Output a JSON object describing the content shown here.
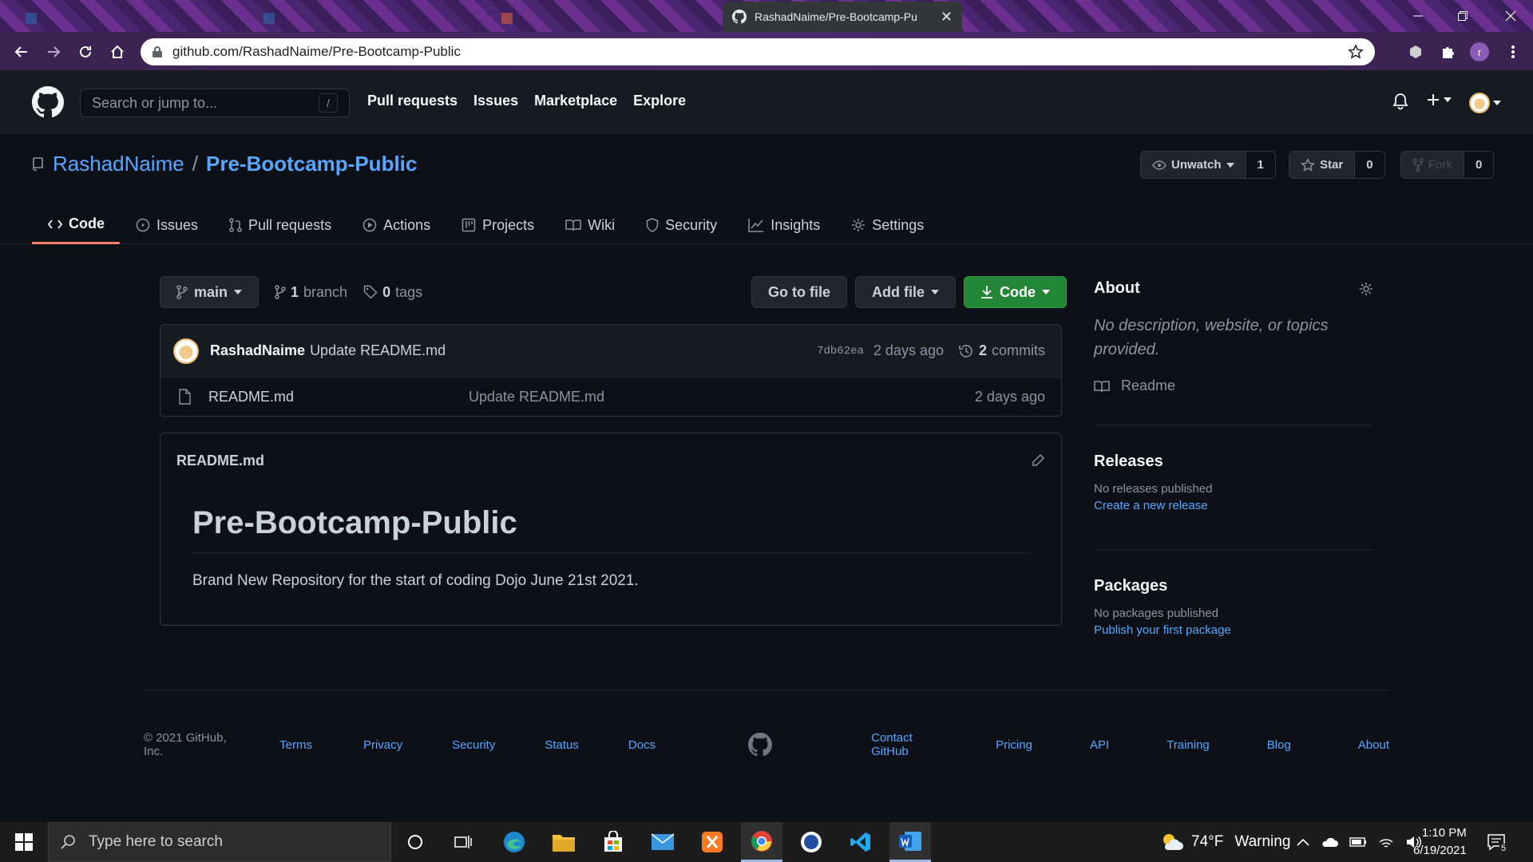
{
  "browser": {
    "active_tab_title": "RashadNaime/Pre-Bootcamp-Pu",
    "url": "github.com/RashadNaime/Pre-Bootcamp-Public",
    "profile_initial": "r"
  },
  "gh_header": {
    "search_placeholder": "Search or jump to...",
    "search_shortcut": "/",
    "nav": [
      "Pull requests",
      "Issues",
      "Marketplace",
      "Explore"
    ]
  },
  "repo": {
    "owner": "RashadNaime",
    "separator": "/",
    "name": "Pre-Bootcamp-Public",
    "unwatch_label": "Unwatch",
    "watch_count": "1",
    "star_label": "Star",
    "star_count": "0",
    "fork_label": "Fork",
    "fork_count": "0"
  },
  "tabs": [
    "Code",
    "Issues",
    "Pull requests",
    "Actions",
    "Projects",
    "Wiki",
    "Security",
    "Insights",
    "Settings"
  ],
  "file_nav": {
    "branch": "main",
    "branch_count": "1",
    "branch_word": "branch",
    "tag_count": "0",
    "tag_word": "tags",
    "go_to_file": "Go to file",
    "add_file": "Add file",
    "code": "Code"
  },
  "latest_commit": {
    "author": "RashadNaime",
    "message": "Update README.md",
    "sha": "7db62ea",
    "time": "2 days ago",
    "commit_count": "2",
    "commit_word": "commits"
  },
  "files": [
    {
      "name": "README.md",
      "message": "Update README.md",
      "time": "2 days ago"
    }
  ],
  "readme": {
    "filename": "README.md",
    "heading": "Pre-Bootcamp-Public",
    "body": "Brand New Repository for the start of coding Dojo June 21st 2021."
  },
  "sidebar": {
    "about_title": "About",
    "about_text": "No description, website, or topics provided.",
    "readme_label": "Readme",
    "releases_title": "Releases",
    "releases_text": "No releases published",
    "releases_link": "Create a new release",
    "packages_title": "Packages",
    "packages_text": "No packages published",
    "packages_link": "Publish your first package"
  },
  "footer": {
    "copyright": "© 2021 GitHub, Inc.",
    "left_links": [
      "Terms",
      "Privacy",
      "Security",
      "Status",
      "Docs"
    ],
    "right_links": [
      "Contact GitHub",
      "Pricing",
      "API",
      "Training",
      "Blog",
      "About"
    ]
  },
  "taskbar": {
    "search_placeholder": "Type here to search",
    "weather": "74°F",
    "weather_status": "Warning",
    "time": "1:10 PM",
    "date": "6/19/2021",
    "notification_count": "5"
  },
  "colors": {
    "accent_link": "#58a6ff",
    "active_tab_underline": "#f78166",
    "code_button": "#238636",
    "page_bg": "#0d1117",
    "header_bg": "#161b22"
  }
}
